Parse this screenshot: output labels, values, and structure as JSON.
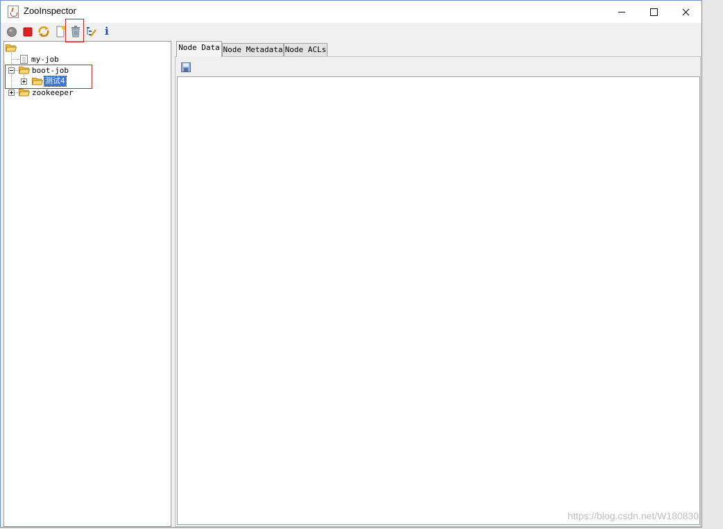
{
  "window": {
    "title": "ZooInspector"
  },
  "toolbar": {
    "buttons": [
      {
        "icon": "connect-icon",
        "tooltip": ""
      },
      {
        "icon": "disconnect-icon"
      },
      {
        "icon": "refresh-icon"
      },
      {
        "icon": "add-node-icon"
      },
      {
        "icon": "delete-node-icon"
      },
      {
        "icon": "tree-settings-icon"
      },
      {
        "icon": "info-icon"
      }
    ],
    "info_glyph": "i"
  },
  "tree": {
    "nodes": [
      {
        "label": "my-job"
      },
      {
        "label": "boot-job"
      },
      {
        "label": "测试4"
      },
      {
        "label": "zookeeper"
      }
    ]
  },
  "tabs": [
    {
      "label": "Node Data"
    },
    {
      "label": "Node Metadata"
    },
    {
      "label": "Node ACLs"
    }
  ],
  "watermark": "https://blog.csdn.net/W180830",
  "colors": {
    "selection": "#3875d7",
    "highlight": "#d02020",
    "folder": "#f0c040"
  }
}
